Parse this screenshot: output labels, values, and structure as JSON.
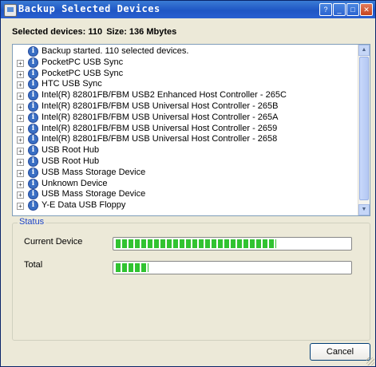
{
  "window": {
    "title": "Backup Selected Devices",
    "buttons": [
      "help",
      "minimize",
      "maximize",
      "close"
    ]
  },
  "summary": {
    "devices_label": "Selected devices: 110",
    "size_label": "Size: 136 Mbytes"
  },
  "tree": {
    "items": [
      {
        "label": "Backup started. 110 selected devices.",
        "expandable": false
      },
      {
        "label": "PocketPC USB Sync",
        "expandable": true
      },
      {
        "label": "PocketPC USB Sync",
        "expandable": true
      },
      {
        "label": "HTC USB Sync",
        "expandable": true
      },
      {
        "label": "Intel(R) 82801FB/FBM USB2 Enhanced Host Controller - 265C",
        "expandable": true
      },
      {
        "label": "Intel(R) 82801FB/FBM USB Universal Host Controller - 265B",
        "expandable": true
      },
      {
        "label": "Intel(R) 82801FB/FBM USB Universal Host Controller - 265A",
        "expandable": true
      },
      {
        "label": "Intel(R) 82801FB/FBM USB Universal Host Controller - 2659",
        "expandable": true
      },
      {
        "label": "Intel(R) 82801FB/FBM USB Universal Host Controller - 2658",
        "expandable": true
      },
      {
        "label": "USB Root Hub",
        "expandable": true
      },
      {
        "label": "USB Root Hub",
        "expandable": true
      },
      {
        "label": "USB Mass Storage Device",
        "expandable": true
      },
      {
        "label": "Unknown Device",
        "expandable": true
      },
      {
        "label": "USB Mass Storage Device",
        "expandable": true
      },
      {
        "label": "Y-E Data USB Floppy",
        "expandable": true
      }
    ],
    "item_icon": "info-icon"
  },
  "status": {
    "legend": "Status",
    "current_device_label": "Current Device",
    "current_device_progress": 0.69,
    "total_label": "Total",
    "total_progress": 0.14,
    "bar_color": "#31c331"
  },
  "actions": {
    "cancel_label": "Cancel"
  },
  "colors": {
    "titlebar": "#1f56c4",
    "legend_text": "#1e45c8"
  }
}
